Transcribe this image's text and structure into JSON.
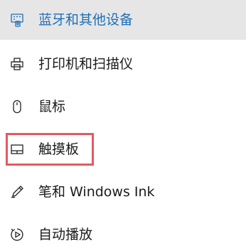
{
  "nav": {
    "items": [
      {
        "label": "蓝牙和其他设备",
        "icon": "bluetooth-devices-icon",
        "selected": true
      },
      {
        "label": "打印机和扫描仪",
        "icon": "printer-icon",
        "selected": false
      },
      {
        "label": "鼠标",
        "icon": "mouse-icon",
        "selected": false
      },
      {
        "label": "触摸板",
        "icon": "touchpad-icon",
        "selected": false,
        "highlighted": true
      },
      {
        "label": "笔和 Windows Ink",
        "icon": "pen-icon",
        "selected": false
      },
      {
        "label": "自动播放",
        "icon": "autoplay-icon",
        "selected": false
      }
    ]
  },
  "colors": {
    "selected_background": "#e6e6e6",
    "selected_text": "#1f6fb8",
    "text": "#1b1b1b",
    "highlight_border": "#e35a61"
  }
}
